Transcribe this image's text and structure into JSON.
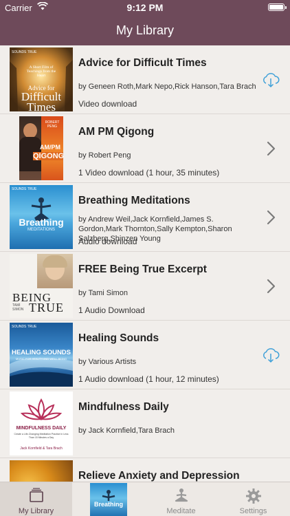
{
  "status_bar": {
    "carrier": "Carrier",
    "time": "9:12 PM"
  },
  "nav": {
    "title": "My Library"
  },
  "items": [
    {
      "title": "Advice for Difficult Times",
      "authors": "by Geneen Roth,Mark Nepo,Rick Hanson,Tara Brach",
      "meta": "Video download",
      "accessory": "download-cloud-icon",
      "cover_text": [
        "A Short Film of Teachings from the Heart",
        "Advice for",
        "Difficult",
        "Times"
      ]
    },
    {
      "title": "AM PM Qigong",
      "authors": "by Robert Peng",
      "meta": "1 Video download (1 hour, 35 minutes)",
      "accessory": "chevron-right-icon",
      "cover_text": [
        "ROBERT PENG",
        "AM/PM",
        "QIGONG"
      ]
    },
    {
      "title": "Breathing Meditations",
      "authors": "by Andrew Weil,Jack Kornfield,James S. Gordon,Mark Thornton,Sally Kempton,Sharon Salzberg,Shinzen Young",
      "meta": "Audio download",
      "accessory": "chevron-right-icon",
      "cover_text": [
        "SOUNDS TRUE",
        "Breathing",
        "MEDITATIONS"
      ]
    },
    {
      "title": "FREE Being True Excerpt",
      "authors": "by Tami Simon",
      "meta": "1 Audio Download",
      "accessory": "chevron-right-icon",
      "cover_text": [
        "BEING",
        "TAMI SIMON",
        "TRUE"
      ]
    },
    {
      "title": "Healing Sounds",
      "authors": "by Various Artists",
      "meta": "1 Audio download (1 hour, 12 minutes)",
      "accessory": "download-cloud-icon",
      "cover_text": [
        "SOUNDS TRUE",
        "HEALING SOUNDS",
        "MUSIC FOR HEALTH AND WELL-BEING"
      ]
    },
    {
      "title": "Mindfulness Daily",
      "authors": "by Jack Kornfield,Tara Brach",
      "meta": "",
      "accessory": "",
      "cover_text": [
        "MINDFULNESS DAILY",
        "Create a Life-Changing Meditation Practice in Less Than 15 Minutes a Day",
        "Jack Kornfield & Tara Brach"
      ]
    },
    {
      "title": "Relieve Anxiety and Depression",
      "authors": "",
      "meta": "",
      "accessory": "",
      "cover_text": []
    }
  ],
  "tabs": [
    {
      "label": "My Library",
      "icon": "library-stack-icon"
    },
    {
      "label": "",
      "icon": "now-playing-artwork"
    },
    {
      "label": "Meditate",
      "icon": "meditate-figure-icon"
    },
    {
      "label": "Settings",
      "icon": "gear-icon"
    }
  ],
  "now_playing": {
    "cover_text": "Breathing"
  },
  "colors": {
    "nav": "#6e4a5a",
    "background": "#f1eeeb",
    "accent": "#5a3f4c",
    "download": "#3fa0d8"
  }
}
